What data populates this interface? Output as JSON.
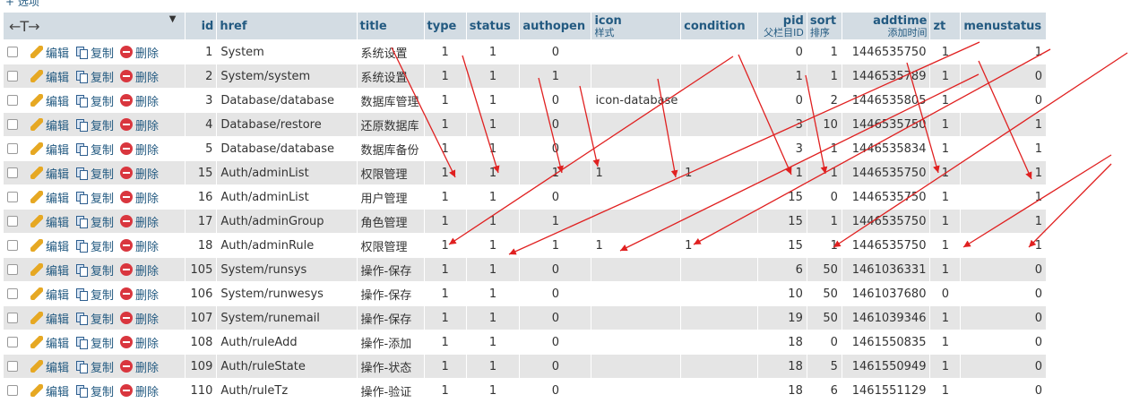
{
  "options_link": "+ 选项",
  "actions": {
    "edit": "编辑",
    "copy": "复制",
    "delete": "删除"
  },
  "columns": [
    {
      "key": "id",
      "label": "id",
      "sub": "",
      "align": "r"
    },
    {
      "key": "href",
      "label": "href",
      "sub": "",
      "align": "l"
    },
    {
      "key": "title",
      "label": "title",
      "sub": "",
      "align": "l"
    },
    {
      "key": "type",
      "label": "type",
      "sub": "",
      "align": "l"
    },
    {
      "key": "status",
      "label": "status",
      "sub": "",
      "align": "l"
    },
    {
      "key": "authopen",
      "label": "authopen",
      "sub": "",
      "align": "l"
    },
    {
      "key": "icon",
      "label": "icon",
      "sub": "样式",
      "align": "l"
    },
    {
      "key": "condition",
      "label": "condition",
      "sub": "",
      "align": "l"
    },
    {
      "key": "pid",
      "label": "pid",
      "sub": "父栏目ID",
      "align": "r"
    },
    {
      "key": "sort",
      "label": "sort",
      "sub": "排序",
      "align": "l"
    },
    {
      "key": "addtime",
      "label": "addtime",
      "sub": "添加时间",
      "align": "r"
    },
    {
      "key": "zt",
      "label": "zt",
      "sub": "",
      "align": "l"
    },
    {
      "key": "menustatus",
      "label": "menustatus",
      "sub": "",
      "align": "l"
    }
  ],
  "rows": [
    {
      "id": "1",
      "href": "System",
      "title": "系统设置",
      "type": "1",
      "status": "1",
      "authopen": "0",
      "icon": "",
      "condition": "",
      "pid": "0",
      "sort": "1",
      "addtime": "1446535750",
      "zt": "1",
      "menustatus": "1"
    },
    {
      "id": "2",
      "href": "System/system",
      "title": "系统设置",
      "type": "1",
      "status": "1",
      "authopen": "1",
      "icon": "",
      "condition": "",
      "pid": "1",
      "sort": "1",
      "addtime": "1446535789",
      "zt": "1",
      "menustatus": "0"
    },
    {
      "id": "3",
      "href": "Database/database",
      "title": "数据库管理",
      "type": "1",
      "status": "1",
      "authopen": "0",
      "icon": "icon-database",
      "condition": "",
      "pid": "0",
      "sort": "2",
      "addtime": "1446535805",
      "zt": "1",
      "menustatus": "0"
    },
    {
      "id": "4",
      "href": "Database/restore",
      "title": "还原数据库",
      "type": "1",
      "status": "1",
      "authopen": "0",
      "icon": "",
      "condition": "",
      "pid": "3",
      "sort": "10",
      "addtime": "1446535750",
      "zt": "1",
      "menustatus": "1"
    },
    {
      "id": "5",
      "href": "Database/database",
      "title": "数据库备份",
      "type": "1",
      "status": "1",
      "authopen": "0",
      "icon": "",
      "condition": "",
      "pid": "3",
      "sort": "1",
      "addtime": "1446535834",
      "zt": "1",
      "menustatus": "1"
    },
    {
      "id": "15",
      "href": "Auth/adminList",
      "title": "权限管理",
      "type": "1",
      "status": "1",
      "authopen": "1",
      "icon": "1",
      "condition": "1",
      "pid": "1",
      "sort": "1",
      "addtime": "1446535750",
      "zt": "1",
      "menustatus": "1"
    },
    {
      "id": "16",
      "href": "Auth/adminList",
      "title": "用户管理",
      "type": "1",
      "status": "1",
      "authopen": "0",
      "icon": "",
      "condition": "",
      "pid": "15",
      "sort": "0",
      "addtime": "1446535750",
      "zt": "1",
      "menustatus": "1"
    },
    {
      "id": "17",
      "href": "Auth/adminGroup",
      "title": "角色管理",
      "type": "1",
      "status": "1",
      "authopen": "1",
      "icon": "",
      "condition": "",
      "pid": "15",
      "sort": "1",
      "addtime": "1446535750",
      "zt": "1",
      "menustatus": "1"
    },
    {
      "id": "18",
      "href": "Auth/adminRule",
      "title": "权限管理",
      "type": "1",
      "status": "1",
      "authopen": "1",
      "icon": "1",
      "condition": "1",
      "pid": "15",
      "sort": "1",
      "addtime": "1446535750",
      "zt": "1",
      "menustatus": "1"
    },
    {
      "id": "105",
      "href": "System/runsys",
      "title": "操作-保存",
      "type": "1",
      "status": "1",
      "authopen": "0",
      "icon": "",
      "condition": "",
      "pid": "6",
      "sort": "50",
      "addtime": "1461036331",
      "zt": "1",
      "menustatus": "0"
    },
    {
      "id": "106",
      "href": "System/runwesys",
      "title": "操作-保存",
      "type": "1",
      "status": "1",
      "authopen": "0",
      "icon": "",
      "condition": "",
      "pid": "10",
      "sort": "50",
      "addtime": "1461037680",
      "zt": "0",
      "menustatus": "0"
    },
    {
      "id": "107",
      "href": "System/runemail",
      "title": "操作-保存",
      "type": "1",
      "status": "1",
      "authopen": "0",
      "icon": "",
      "condition": "",
      "pid": "19",
      "sort": "50",
      "addtime": "1461039346",
      "zt": "1",
      "menustatus": "0"
    },
    {
      "id": "108",
      "href": "Auth/ruleAdd",
      "title": "操作-添加",
      "type": "1",
      "status": "1",
      "authopen": "0",
      "icon": "",
      "condition": "",
      "pid": "18",
      "sort": "0",
      "addtime": "1461550835",
      "zt": "1",
      "menustatus": "0"
    },
    {
      "id": "109",
      "href": "Auth/ruleState",
      "title": "操作-状态",
      "type": "1",
      "status": "1",
      "authopen": "0",
      "icon": "",
      "condition": "",
      "pid": "18",
      "sort": "5",
      "addtime": "1461550949",
      "zt": "1",
      "menustatus": "0"
    },
    {
      "id": "110",
      "href": "Auth/ruleTz",
      "title": "操作-验证",
      "type": "1",
      "status": "1",
      "authopen": "0",
      "icon": "",
      "condition": "",
      "pid": "18",
      "sort": "6",
      "addtime": "1461551129",
      "zt": "1",
      "menustatus": "0"
    }
  ],
  "annotation_color": "#e02020"
}
